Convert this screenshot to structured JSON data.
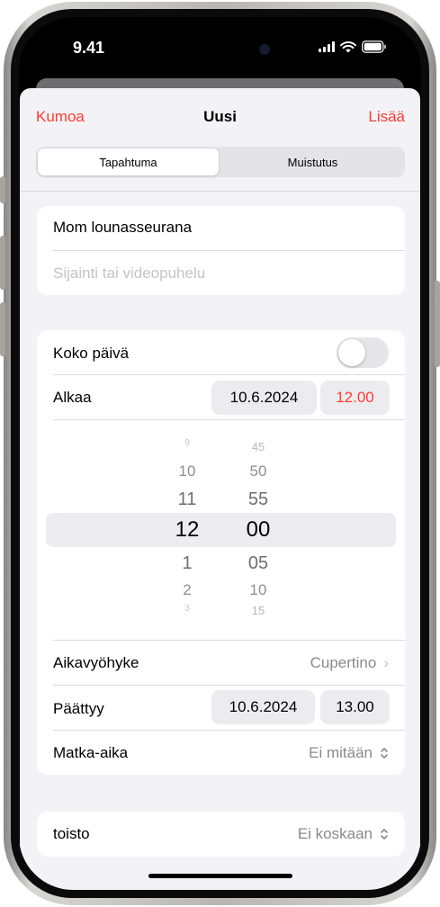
{
  "status": {
    "time": "9.41"
  },
  "nav": {
    "cancel": "Kumoa",
    "title": "Uusi",
    "add": "Lisää"
  },
  "segment": {
    "event": "Tapahtuma",
    "reminder": "Muistutus"
  },
  "event": {
    "title": "Mom lounasseurana",
    "location_placeholder": "Sijainti tai videopuhelu"
  },
  "allday": {
    "label": "Koko päivä",
    "on": false
  },
  "starts": {
    "label": "Alkaa",
    "date": "10.6.2024",
    "time": "12.00"
  },
  "picker": {
    "hours": [
      "9",
      "10",
      "11",
      "12",
      "1",
      "2",
      "3"
    ],
    "minutes": [
      "45",
      "50",
      "55",
      "00",
      "05",
      "10",
      "15"
    ]
  },
  "timezone": {
    "label": "Aikavyöhyke",
    "value": "Cupertino"
  },
  "ends": {
    "label": "Päättyy",
    "date": "10.6.2024",
    "time": "13.00"
  },
  "travel": {
    "label": "Matka-aika",
    "value": "Ei mitään"
  },
  "repeat": {
    "label": "toisto",
    "value": "Ei koskaan"
  },
  "colors": {
    "accent": "#ff3b30",
    "background": "#f2f2f7"
  }
}
